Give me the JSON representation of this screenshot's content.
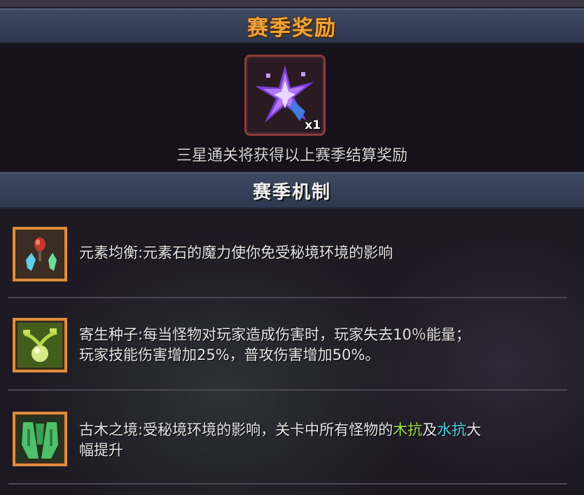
{
  "season_reward": {
    "title": "赛季奖励",
    "item": {
      "icon": "purple-star-crystal-icon",
      "quantity": "x1"
    },
    "caption": "三星通关将获得以上赛季结算奖励"
  },
  "season_mechanics": {
    "title": "赛季机制",
    "items": [
      {
        "icon": "element-stones-icon",
        "line1": "元素均衡:元素石的魔力使你免受秘境环境的影响",
        "line2": ""
      },
      {
        "icon": "parasite-seed-icon",
        "line1": "寄生种子:每当怪物对玩家造成伤害时，玩家失去10％能量；",
        "line2": "玩家技能伤害增加25%，普攻伤害增加50%。"
      },
      {
        "icon": "ancient-wood-icon",
        "line1_a": "古木之境:受秘境环境的影响，关卡中所有怪物的",
        "line1_wood": "木抗",
        "line1_and": "及",
        "line1_water": "水抗",
        "line1_b": "大",
        "line2": "幅提升"
      }
    ]
  },
  "colors": {
    "title_gold": "#f0a43a",
    "frame_orange": "#e08c3c",
    "wood_green": "#9be24a",
    "water_blue": "#4fd2e6"
  }
}
